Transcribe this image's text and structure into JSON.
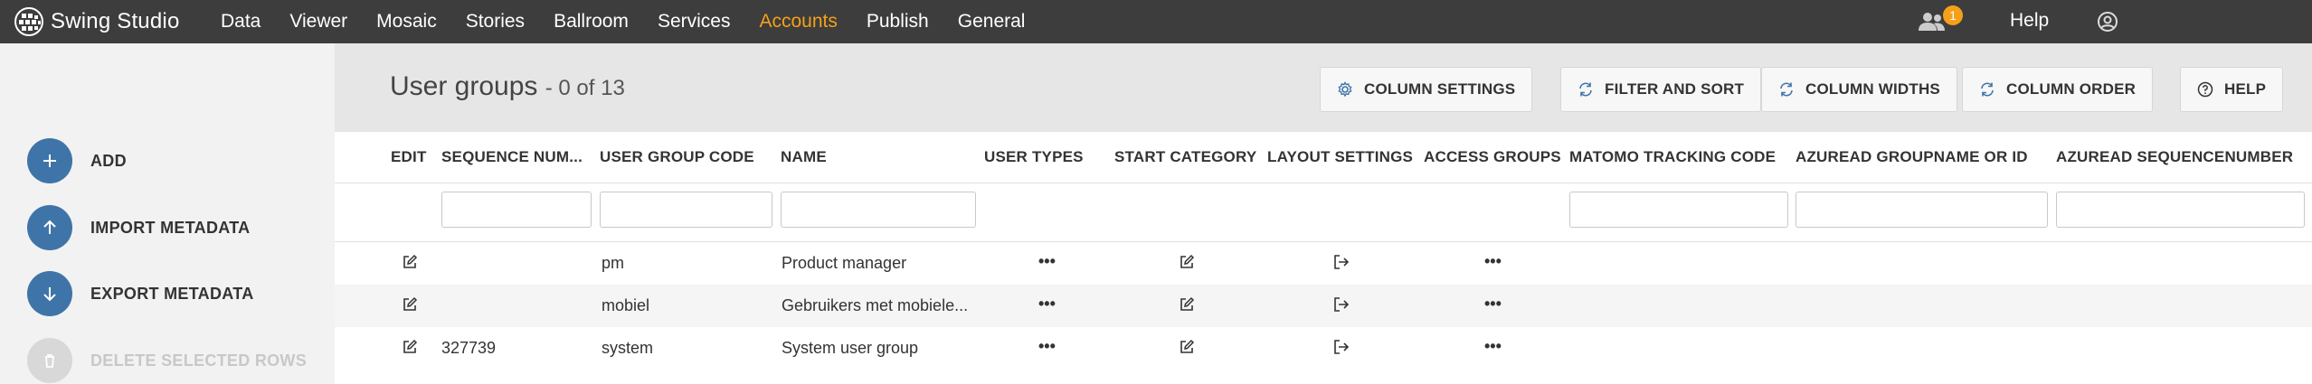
{
  "app": {
    "brand": "Swing Studio"
  },
  "menu": [
    "Data",
    "Viewer",
    "Mosaic",
    "Stories",
    "Ballroom",
    "Services",
    "Accounts",
    "Publish",
    "General"
  ],
  "active_menu": "Accounts",
  "topright": {
    "notification_count": "1",
    "help_label": "Help"
  },
  "colors": {
    "topbar": "#3d3d3d",
    "accent": "#f5a01a",
    "action_blue": "#3f74a8"
  },
  "sidebar": {
    "actions": [
      {
        "label": "ADD",
        "icon": "plus-icon",
        "enabled": true
      },
      {
        "label": "IMPORT METADATA",
        "icon": "arrow-up-icon",
        "enabled": true
      },
      {
        "label": "EXPORT METADATA",
        "icon": "arrow-down-icon",
        "enabled": true
      },
      {
        "label": "DELETE SELECTED ROWS",
        "icon": "trash-icon",
        "enabled": false
      }
    ]
  },
  "page": {
    "title": "User groups",
    "count": "- 0 of 13"
  },
  "toolbar": {
    "column_settings": "COLUMN SETTINGS",
    "filter_and_sort": "FILTER AND SORT",
    "column_widths": "COLUMN WIDTHS",
    "column_order": "COLUMN ORDER",
    "help": "HELP"
  },
  "table": {
    "columns": [
      "EDIT",
      "SEQUENCE NUM...",
      "USER GROUP CODE",
      "NAME",
      "USER TYPES",
      "START CATEGORY",
      "LAYOUT SETTINGS",
      "ACCESS GROUPS",
      "MATOMO TRACKING CODE",
      "AZUREAD GROUPNAME OR ID",
      "AZUREAD SEQUENCENUMBER"
    ],
    "rows": [
      {
        "sequence": "",
        "code": "pm",
        "name": "Product manager"
      },
      {
        "sequence": "",
        "code": "mobiel",
        "name": "Gebruikers met mobiele..."
      },
      {
        "sequence": "327739",
        "code": "system",
        "name": "System user group"
      }
    ],
    "ellipsis": "•••"
  }
}
